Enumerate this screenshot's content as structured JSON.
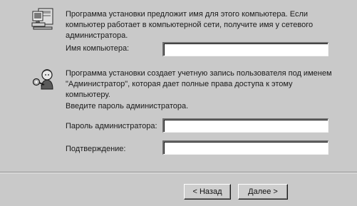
{
  "computer_section": {
    "description": "Программа установки предложит имя для этого компьютера. Если компьютер работает в компьютерной сети, получите имя у сетевого администратора.",
    "computer_name_label": "Имя компьютера:",
    "computer_name_value": ""
  },
  "admin_section": {
    "description": "Программа установки создает учетную запись пользователя под именем \"Администратор\", которая дает полные права доступа к этому компьютеру.",
    "instruction": "Введите пароль администратора.",
    "password_label": "Пароль администратора:",
    "password_value": "",
    "confirm_label": "Подтверждение:",
    "confirm_value": ""
  },
  "buttons": {
    "back_label": "< Назад",
    "next_label": "Далее >"
  },
  "icons": {
    "computer_icon": "computer-icon",
    "admin_icon": "user-key-icon"
  }
}
